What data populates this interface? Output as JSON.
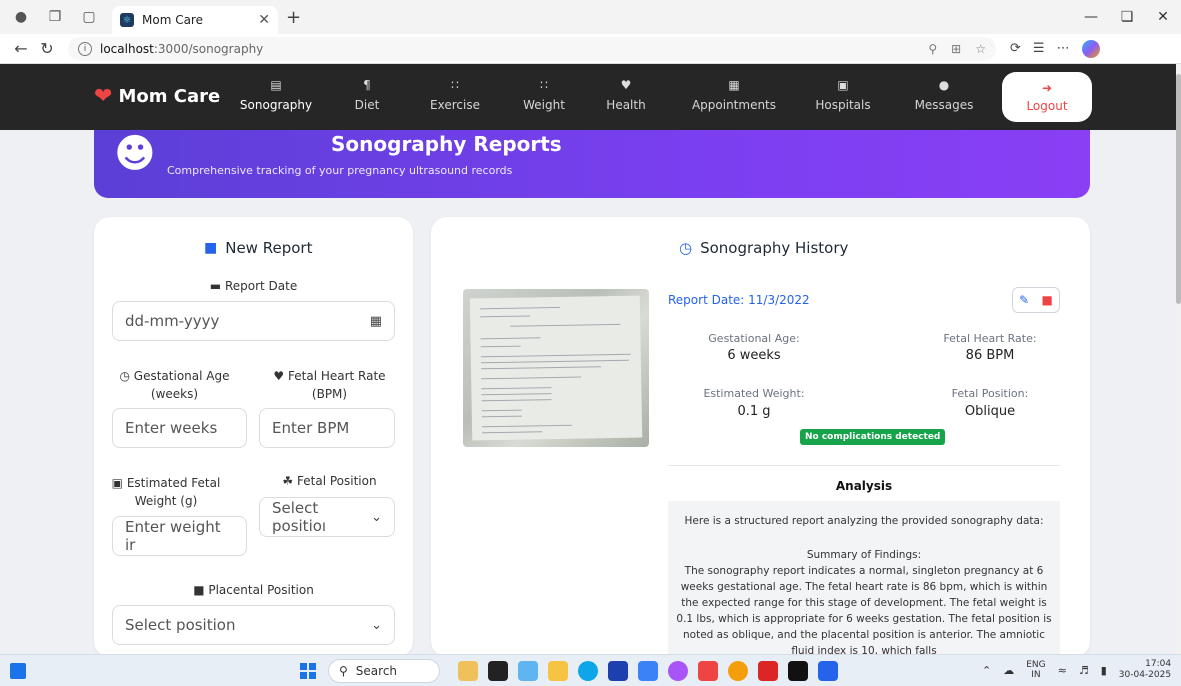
{
  "browser": {
    "tab_title": "Mom Care",
    "url_host": "localhost",
    "url_path": ":3000/sonography"
  },
  "nav": {
    "brand": "Mom Care",
    "items": [
      {
        "label": "Sonography",
        "icon": "chart-icon"
      },
      {
        "label": "Diet",
        "icon": "utensils-icon"
      },
      {
        "label": "Exercise",
        "icon": "dumbbell-icon"
      },
      {
        "label": "Weight",
        "icon": "weight-icon"
      },
      {
        "label": "Health",
        "icon": "heartbeat-icon"
      },
      {
        "label": "Appointments",
        "icon": "calendar-icon"
      },
      {
        "label": "Hospitals",
        "icon": "hospital-icon"
      },
      {
        "label": "Messages",
        "icon": "chat-icon"
      }
    ],
    "logout": "Logout"
  },
  "hero": {
    "title": "Sonography Reports",
    "subtitle": "Comprehensive tracking of your pregnancy ultrasound records"
  },
  "form": {
    "title": "New Report",
    "report_date_label": "Report Date",
    "report_date_placeholder": "dd-mm-yyyy",
    "gest_age_label": "Gestational Age (weeks)",
    "gest_age_placeholder": "Enter weeks",
    "fhr_label": "Fetal Heart Rate (BPM)",
    "fhr_placeholder": "Enter BPM",
    "weight_label": "Estimated Fetal Weight (g)",
    "weight_placeholder": "Enter weight ir",
    "position_label": "Fetal Position",
    "position_value": "Select positioı",
    "placental_label": "Placental Position",
    "placental_value": "Select position"
  },
  "history": {
    "title": "Sonography History",
    "report_date": "Report Date: 11/3/2022",
    "gest_age_label": "Gestational Age:",
    "gest_age_value": "6 weeks",
    "fhr_label": "Fetal Heart Rate:",
    "fhr_value": "86 BPM",
    "weight_label": "Estimated Weight:",
    "weight_value": "0.1 g",
    "position_label": "Fetal Position:",
    "position_value": "Oblique",
    "badge": "No complications detected",
    "analysis_title": "Analysis",
    "analysis_intro": "Here is a structured report analyzing the provided sonography data:",
    "analysis_heading": "Summary of Findings:",
    "analysis_body": "The sonography report indicates a normal, singleton pregnancy at 6 weeks gestational age. The fetal heart rate is 86 bpm, which is within the expected range for this stage of development. The fetal weight is 0.1 lbs, which is appropriate for 6 weeks gestation. The fetal position is noted as oblique, and the placental position is anterior. The amniotic fluid index is 10, which falls"
  },
  "taskbar": {
    "search": "Search",
    "lang_top": "ENG",
    "lang_bottom": "IN",
    "time": "17:04",
    "date": "30-04-2025"
  },
  "colors": {
    "accent": "#2563eb",
    "hero_start": "#5b3fd6",
    "hero_end": "#8a3ff5",
    "nav_bg": "#262626",
    "success": "#16a34a",
    "danger": "#ef4444"
  }
}
